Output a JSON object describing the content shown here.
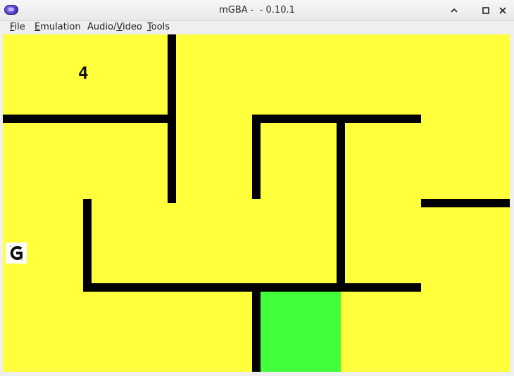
{
  "window": {
    "title": "mGBA -  - 0.10.1",
    "icon": "mgba-app-icon"
  },
  "titlebar_buttons": {
    "minimize_icon": "chevron-up-icon",
    "maximize_icon": "square-icon",
    "close_icon": "close-icon"
  },
  "menu": {
    "items": [
      {
        "label_mnemonic": "F",
        "label_rest": "ile"
      },
      {
        "label_mnemonic": "E",
        "label_rest": "mulation"
      },
      {
        "label_prefix": "Audio/",
        "label_mnemonic": "V",
        "label_rest": "ideo"
      },
      {
        "label_mnemonic": "T",
        "label_rest": "ools"
      }
    ]
  },
  "game": {
    "score": "4",
    "colors": {
      "background": "#ffff3b",
      "wall": "#000000",
      "goal": "#41ff3b"
    },
    "player_icon": "g-sprite-icon"
  }
}
